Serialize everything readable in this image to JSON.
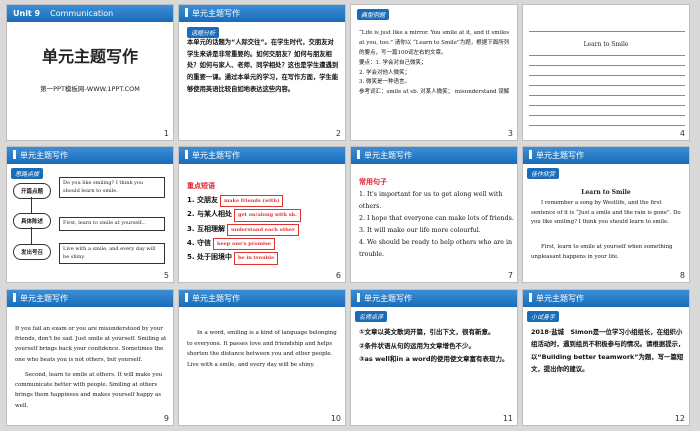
{
  "slides": [
    {
      "number": "1",
      "unit": "Unit 9",
      "header": "Communication",
      "title": "单元主题写作",
      "site": "第一PPT模板网-WWW.1PPT.COM"
    },
    {
      "number": "2",
      "header": "单元主题写作",
      "tag": "话题分析",
      "text": "本单元的话题为“人际交往”。在学生时代，交朋友对学生来讲是非常重要的。如何交朋友？如何与朋友相处？如何与家人、老师、同学相处？这也是学生遭遇到的重要一课。通过本单元的学习，在写作方面，学生能够使用英语比较自如地表达这些内容。"
    },
    {
      "number": "3",
      "tag": "典型例题",
      "lines": [
        "“Life is just like a mirror. You smile at it, and it smiles at you, too.” 请你以 “Learn to Smile”为题，根据下面所列的要点，写一篇100词左右的文章。",
        "要点：1. 学会对自己微笑；",
        "2. 学会对他人微笑；",
        "3. 微笑是一种语言。",
        "参考词汇：smile at sb. 对某人微笑； misunderstand 误解"
      ]
    },
    {
      "number": "4",
      "title": "Learn to Smile"
    },
    {
      "number": "5",
      "header": "单元主题写作",
      "tag": "思路点拨",
      "flow": [
        "开篇点题",
        "具体陈述",
        "发出号召"
      ],
      "boxes": [
        "Do you like smiling? I think you should learn to smile.",
        "First, learn to smile at yourself...",
        "Live with a smile, and every day will be shiny."
      ]
    },
    {
      "number": "6",
      "header": "单元主题写作",
      "label": "重点短语",
      "items": [
        {
          "no": "1",
          "zh": "交朋友",
          "en": "make friends (with)"
        },
        {
          "no": "2",
          "zh": "与某人相处",
          "en": "get on/along with sb."
        },
        {
          "no": "3",
          "zh": "互相理解",
          "en": "understand each other"
        },
        {
          "no": "4",
          "zh": "守信",
          "en": "keep one's promise"
        },
        {
          "no": "5",
          "zh": "处于困境中",
          "en": "be in trouble"
        }
      ]
    },
    {
      "number": "7",
      "header": "单元主题写作",
      "label": "常用句子",
      "items": [
        "1. It's important for us to get along well with others.",
        "2. I hope that everyone can make lots of friends.",
        "3. It will make our life more colourful.",
        "4. We should be ready to help others who are in trouble."
      ]
    },
    {
      "number": "8",
      "header": "单元主题写作",
      "tag": "佳作欣赏",
      "title": "Learn to Smile",
      "text": "I remember a song by Westlife, and the first sentence of it is “Just a smile and the rain is gone”. Do you like smiling? I think you should learn to smile.",
      "text2": "First, learn to smile at yourself when something unpleasant happens in your life."
    },
    {
      "number": "9",
      "header": "单元主题写作",
      "text": "If you fail an exam or you are misunderstood by your friends, don't be sad. Just smile at yourself. Smiling at yourself brings back your confidence. Sometimes the one who beats you is not others, but yourself.",
      "text2": "Second, learn to smile at others. It will make you communicate better with people. Smiling at others brings them happiness and makes yourself happy as well."
    },
    {
      "number": "10",
      "header": "单元主题写作",
      "text": "In a word, smiling is a kind of language belonging to everyone. It passes love and friendship and helps shorten the distance between you and other people. Live with a smile, and every day will be shiny."
    },
    {
      "number": "11",
      "header": "单元主题写作",
      "tag": "名师点评",
      "items": [
        "①文章以英文歌词开篇，引出下文，很有新意。",
        "②条件状语从句的运用为文章增色不少。",
        "③as well和in a word的使用使文章富有表现力。"
      ]
    },
    {
      "number": "12",
      "header": "单元主题写作",
      "tag": "小试身手",
      "text": "2018·盐城　Simon是一位学习小组组长，在组织小组活动时，遇到组员不积极参与的情况。请根据提示，以“Building better teamwork”为题，写一篇短文，提出你的建议。"
    }
  ]
}
